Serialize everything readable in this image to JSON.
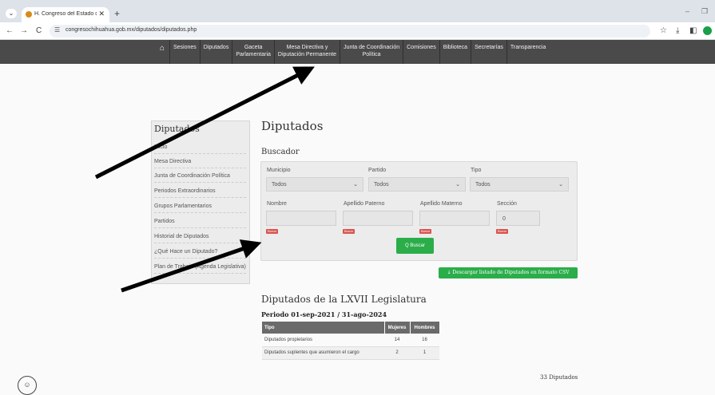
{
  "browser": {
    "tab_title": "H. Congreso del Estado de Chih",
    "url": "congresochihuahua.gob.mx/diputados/diputados.php",
    "menu_glyph": "⌄",
    "close_glyph": "✕",
    "newtab_glyph": "+",
    "minimize_glyph": "–",
    "restore_glyph": "❐",
    "back_glyph": "←",
    "forward_glyph": "→",
    "reload_glyph": "C",
    "tune_glyph": "☰",
    "star_glyph": "☆",
    "download_glyph": "⤓",
    "sidepanel_glyph": "◧",
    "profile_glyph": "●"
  },
  "nav": {
    "home_glyph": "⌂",
    "items": [
      [
        "Sesiones"
      ],
      [
        "Diputados"
      ],
      [
        "Gaceta",
        "Parlamentaria"
      ],
      [
        "Mesa Directiva y",
        "Diputación Permanente"
      ],
      [
        "Junta de Coordinación",
        "Política"
      ],
      [
        "Comisiones"
      ],
      [
        "Biblioteca"
      ],
      [
        "Secretarías"
      ],
      [
        "Transparencia"
      ]
    ]
  },
  "sidebar": {
    "title": "Diputados",
    "items": [
      "Inicio",
      "Mesa Directiva",
      "Junta de Coordinación Política",
      "Periodos Extraordinarios",
      "Grupos Parlamentarios",
      "Partidos",
      "Historial de Diputados",
      "¿Qué Hace un Diputado?",
      "Plan de Trabajo (Agenda Legislativa)"
    ]
  },
  "main": {
    "title": "Diputados",
    "search_heading": "Buscador",
    "filters": {
      "municipio_label": "Municipio",
      "municipio_value": "Todos",
      "partido_label": "Partido",
      "partido_value": "Todos",
      "tipo_label": "Tipo",
      "tipo_value": "Todos",
      "nombre_label": "Nombre",
      "paterno_label": "Apellido Paterno",
      "materno_label": "Apellido Materno",
      "seccion_label": "Sección",
      "seccion_value": "0",
      "clear_label": "Borrar",
      "chevron_glyph": "⌄"
    },
    "search_button": "Q Buscar",
    "csv_button": "⤓ Descargar listado de Diputados en formato CSV",
    "legislature_title": "Diputados de la LXVII Legislatura",
    "period": "Periodo 01-sep-2021 / 31-ago-2024",
    "table": {
      "headers": [
        "Tipo",
        "Mujeres",
        "Hombres"
      ],
      "rows": [
        [
          "Diputados propietarios",
          "14",
          "16"
        ],
        [
          "Diputados suplentes que asumieron el cargo",
          "2",
          "1"
        ]
      ]
    },
    "count": "33 Diputados",
    "seal_glyph": "☺"
  },
  "colors": {
    "nav_bg": "#4a4a4a",
    "button_green": "#2bad4a",
    "clear_red": "#d9534f",
    "arrow": "#000000"
  }
}
